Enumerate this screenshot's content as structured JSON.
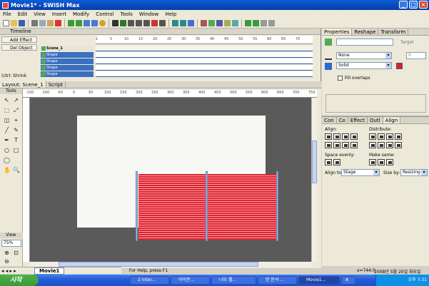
{
  "window": {
    "title": "Movie1* - SWiSH Max"
  },
  "menu": [
    "File",
    "Edit",
    "View",
    "Insert",
    "Modify",
    "Control",
    "Tools",
    "Window",
    "Help"
  ],
  "timeline": {
    "title": "Timeline",
    "add_effect": "Add Effect",
    "del_object": "Del Object",
    "scene": "Scene_1",
    "layers": [
      "Shape",
      "Shape",
      "Shape",
      "Shape"
    ],
    "ruler": [
      "1",
      "5",
      "10",
      "15",
      "20",
      "25",
      "30",
      "35",
      "40",
      "45",
      "50",
      "55",
      "60",
      "65",
      "70"
    ],
    "ctrl_label": "(ctrl: Shrink"
  },
  "properties": {
    "tabs": [
      "Properties",
      "Reshape",
      "Transform"
    ],
    "target_label": "Target",
    "line_style": "None",
    "fill_style": "Solid",
    "fill_overlaps": "Fill overlaps",
    "spin_value": "0"
  },
  "align_panel": {
    "tabs": [
      "Con",
      "Co",
      "Effect",
      "Outl",
      "Align"
    ],
    "align_label": "Align:",
    "distribute_label": "Distribute:",
    "space_evenly": "Space evenly:",
    "make_same": "Make same:",
    "align_to_label": "Align to:",
    "align_to_value": "Stage",
    "size_by_label": "Size by:",
    "size_by_value": "Resizing"
  },
  "layout": {
    "tabs": [
      "Layout: Scene_1",
      "Script"
    ],
    "tools_title": "Tools",
    "view_title": "View",
    "zoom": "75%",
    "hruler": [
      "-150",
      "-100",
      "-50",
      "0",
      "50",
      "100",
      "150",
      "200",
      "250",
      "300",
      "350",
      "400",
      "450",
      "500",
      "550",
      "600",
      "650",
      "700",
      "750"
    ]
  },
  "scene_tab": "Movie1",
  "status": {
    "help": "For Help, press F1",
    "coords": "x=744.0",
    "date": "2008년 5월 20일 화요일"
  },
  "taskbar": {
    "start": "시작",
    "items": [
      "2 Inter...",
      "아이콘...",
      "나모 웹...",
      "한 문서 ...",
      "Movie1...",
      "A"
    ],
    "clock": "오후 7:31"
  }
}
